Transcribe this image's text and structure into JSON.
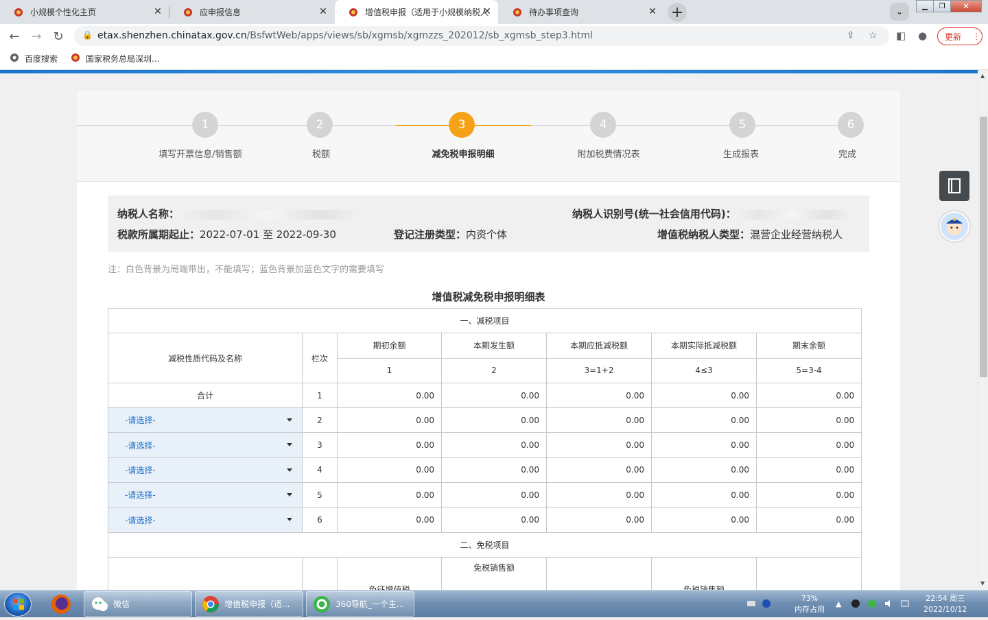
{
  "browser": {
    "tabs": [
      {
        "title": "小规模个性化主页",
        "active": false
      },
      {
        "title": "应申报信息",
        "active": false
      },
      {
        "title": "增值税申报（适用于小规模纳税人",
        "active": true
      },
      {
        "title": "待办事项查询",
        "active": false
      }
    ],
    "url_host": "etax.shenzhen.chinatax.gov.cn",
    "url_path": "/BsfwtWeb/apps/views/sb/xgmsb/xgmzzs_202012/sb_xgmsb_step3.html",
    "update_label": "更新",
    "bookmarks": [
      {
        "label": "百度搜索"
      },
      {
        "label": "国家税务总局深圳..."
      }
    ]
  },
  "steps": [
    {
      "num": "1",
      "label": "填写开票信息/销售额"
    },
    {
      "num": "2",
      "label": "税额"
    },
    {
      "num": "3",
      "label": "减免税申报明细"
    },
    {
      "num": "4",
      "label": "附加税费情况表"
    },
    {
      "num": "5",
      "label": "生成报表"
    },
    {
      "num": "6",
      "label": "完成"
    }
  ],
  "current_step": 3,
  "taxpayer": {
    "name_label": "纳税人名称：",
    "id_label": "纳税人识别号(统一社会信用代码)：",
    "period_label": "税款所属期起止：",
    "period_value": "2022-07-01 至 2022-09-30",
    "reg_type_label": "登记注册类型：",
    "reg_type_value": "内资个体",
    "vat_type_label": "增值税纳税人类型：",
    "vat_type_value": "混营企业经营纳税人"
  },
  "note": "注：白色背景为局端带出，不能填写；蓝色背景加蓝色文字的需要填写",
  "table_title": "增值税减免税申报明细表",
  "section1": {
    "title": "一、减税项目",
    "col_name": "减税性质代码及名称",
    "col_row": "栏次",
    "headers": [
      "期初余额",
      "本期发生额",
      "本期应抵减税额",
      "本期实际抵减税额",
      "期末余额"
    ],
    "formulas": [
      "1",
      "2",
      "3=1+2",
      "4≤3",
      "5=3-4"
    ],
    "rows": [
      {
        "name": "合计",
        "row": "1",
        "values": [
          "0.00",
          "0.00",
          "0.00",
          "0.00",
          "0.00"
        ]
      },
      {
        "name": "-请选择-",
        "row": "2",
        "values": [
          "0.00",
          "0.00",
          "0.00",
          "0.00",
          "0.00"
        ]
      },
      {
        "name": "-请选择-",
        "row": "3",
        "values": [
          "0.00",
          "0.00",
          "0.00",
          "0.00",
          "0.00"
        ]
      },
      {
        "name": "-请选择-",
        "row": "4",
        "values": [
          "0.00",
          "0.00",
          "0.00",
          "0.00",
          "0.00"
        ]
      },
      {
        "name": "-请选择-",
        "row": "5",
        "values": [
          "0.00",
          "0.00",
          "0.00",
          "0.00",
          "0.00"
        ]
      },
      {
        "name": "-请选择-",
        "row": "6",
        "values": [
          "0.00",
          "0.00",
          "0.00",
          "0.00",
          "0.00"
        ]
      }
    ]
  },
  "section2": {
    "title": "二、免税项目",
    "headers": [
      "免征增值税",
      "免税销售额",
      "",
      "免税销售额",
      ""
    ]
  },
  "taskbar": {
    "items": [
      {
        "label": "微信"
      },
      {
        "label": "增值税申报（适..."
      },
      {
        "label": "360导航_一个主..."
      }
    ],
    "cpu": "73%",
    "mem_label": "内存占用",
    "time": "22:54 周三",
    "date": "2022/10/12"
  }
}
